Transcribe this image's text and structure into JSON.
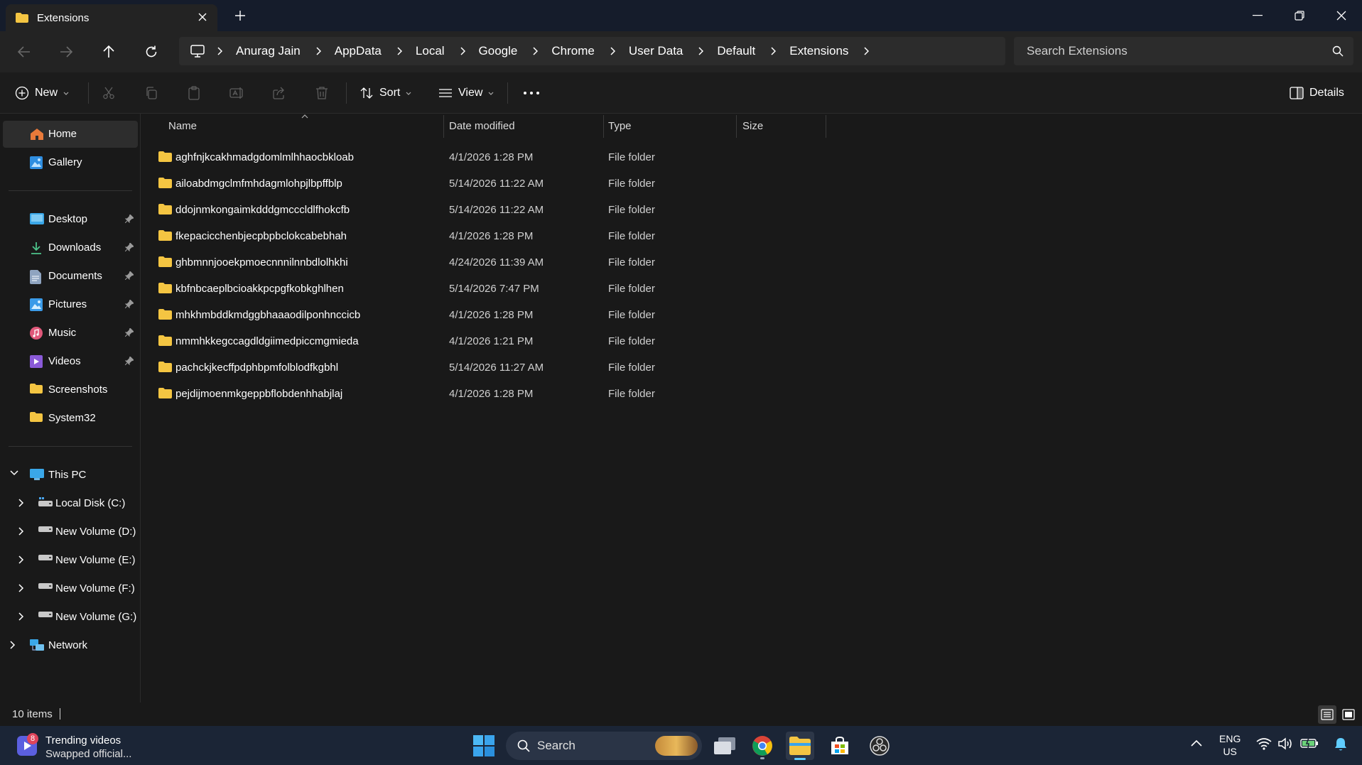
{
  "window": {
    "tab_title": "Extensions",
    "icons": {
      "tab": "folder-icon",
      "close": "close-icon",
      "new_tab": "plus-icon",
      "minimize": "minimize-icon",
      "maximize": "restore-icon",
      "close_window": "close-icon"
    }
  },
  "address": {
    "breadcrumbs": [
      "Anurag Jain",
      "AppData",
      "Local",
      "Google",
      "Chrome",
      "User Data",
      "Default",
      "Extensions"
    ],
    "search_placeholder": "Search Extensions"
  },
  "commandbar": {
    "new_label": "New",
    "sort_label": "Sort",
    "view_label": "View",
    "details_label": "Details"
  },
  "sidebar": {
    "quick": [
      {
        "label": "Home",
        "icon": "home-icon",
        "selected": true
      },
      {
        "label": "Gallery",
        "icon": "gallery-icon"
      }
    ],
    "pinned": [
      {
        "label": "Desktop",
        "icon": "desktop-icon"
      },
      {
        "label": "Downloads",
        "icon": "download-icon"
      },
      {
        "label": "Documents",
        "icon": "documents-icon"
      },
      {
        "label": "Pictures",
        "icon": "pictures-icon"
      },
      {
        "label": "Music",
        "icon": "music-icon"
      },
      {
        "label": "Videos",
        "icon": "videos-icon"
      },
      {
        "label": "Screenshots",
        "icon": "folder-icon"
      },
      {
        "label": "System32",
        "icon": "folder-icon"
      }
    ],
    "this_pc": "This PC",
    "drives": [
      "Local Disk (C:)",
      "New Volume (D:)",
      "New Volume (E:)",
      "New Volume (F:)",
      "New Volume (G:)"
    ],
    "network": "Network"
  },
  "columns": {
    "name": "Name",
    "date": "Date modified",
    "type": "Type",
    "size": "Size"
  },
  "files": [
    {
      "name": "aghfnjkcakhmadgdomlmlhhaocbkloab",
      "date": "4/1/2026 1:28 PM",
      "type": "File folder"
    },
    {
      "name": "ailoabdmgclmfmhdagmlohpjlbpffblp",
      "date": "5/14/2026 11:22 AM",
      "type": "File folder"
    },
    {
      "name": "ddojnmkongaimkdddgmcccldlfhokcfb",
      "date": "5/14/2026 11:22 AM",
      "type": "File folder"
    },
    {
      "name": "fkepacicchenbjecpbpbclokcabebhah",
      "date": "4/1/2026 1:28 PM",
      "type": "File folder"
    },
    {
      "name": "ghbmnnjooekpmoecnnnilnnbdlolhkhi",
      "date": "4/24/2026 11:39 AM",
      "type": "File folder"
    },
    {
      "name": "kbfnbcaeplbcioakkpcpgfkobkghlhen",
      "date": "5/14/2026 7:47 PM",
      "type": "File folder"
    },
    {
      "name": "mhkhmbddkmdggbhaaaodilponhnccicb",
      "date": "4/1/2026 1:28 PM",
      "type": "File folder"
    },
    {
      "name": "nmmhkkegccagdldgiimedpiccmgmieda",
      "date": "4/1/2026 1:21 PM",
      "type": "File folder"
    },
    {
      "name": "pachckjkecffpdphbpmfolblodfkgbhl",
      "date": "5/14/2026 11:27 AM",
      "type": "File folder"
    },
    {
      "name": "pejdijmoenmkgeppbflobdenhhabjlaj",
      "date": "4/1/2026 1:28 PM",
      "type": "File folder"
    }
  ],
  "status": {
    "item_count": "10 items"
  },
  "taskbar": {
    "widget_badge": "8",
    "widget_title": "Trending videos",
    "widget_subtitle": "Swapped official...",
    "search_placeholder": "Search",
    "lang_line1": "ENG",
    "lang_line2": "US"
  },
  "colors": {
    "folder": "#f4c542",
    "accent": "#60cdff",
    "taskbar": "#1b2536",
    "titlebar": "#151c2b"
  }
}
